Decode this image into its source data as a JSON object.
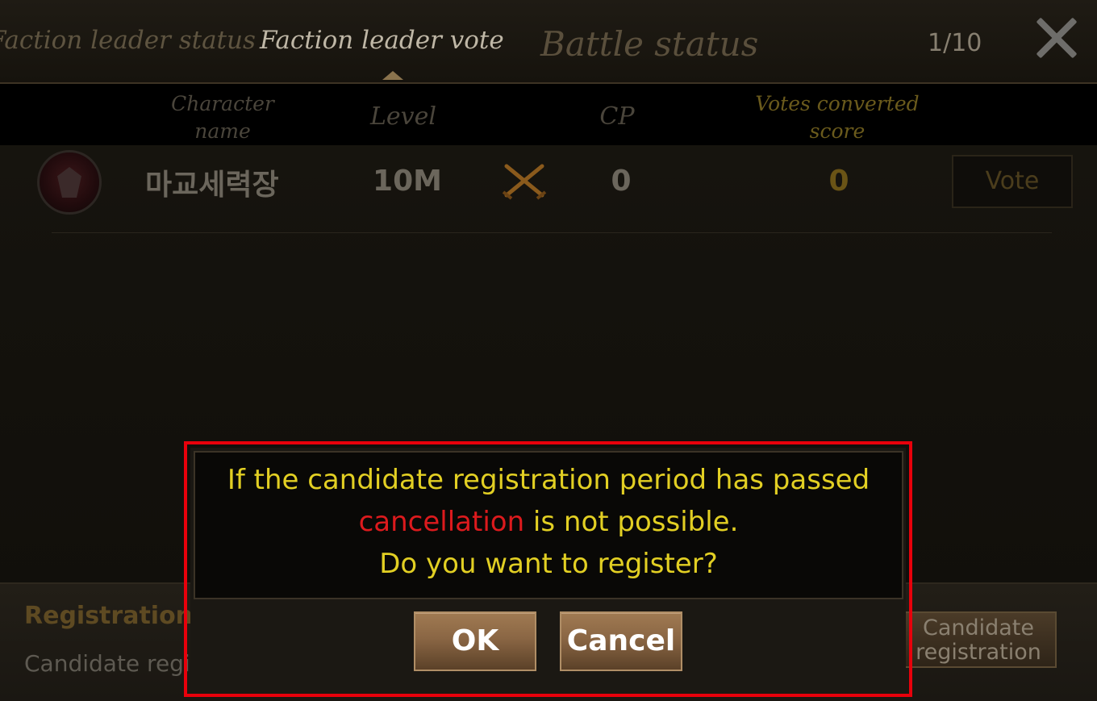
{
  "header": {
    "tabs": [
      {
        "label": "Faction leader status"
      },
      {
        "label": "Faction leader vote"
      },
      {
        "label": "Battle status"
      }
    ],
    "page_counter": "1/10",
    "close_icon": "close-icon"
  },
  "table": {
    "columns": [
      "Character name",
      "Level",
      "CP",
      "Votes converted score"
    ],
    "rows": [
      {
        "avatar_icon": "character-avatar",
        "name": "마교세력장",
        "level": "10M",
        "class_icon": "crossed-swords-icon",
        "cp": "0",
        "votes": "0",
        "vote_label": "Vote"
      }
    ]
  },
  "footer": {
    "title": "Registration Period",
    "text": "Candidate registration",
    "candidate_button_line1": "Candidate",
    "candidate_button_line2": "registration"
  },
  "dialog": {
    "line1": "If the candidate registration period has passed",
    "line2_highlight": "cancellation",
    "line2_rest": " is not possible.",
    "line3": "Do you want to register?",
    "ok_label": "OK",
    "cancel_label": "Cancel"
  },
  "colors": {
    "highlight_red": "#dc1a1d",
    "message_yellow": "#e2cf23",
    "outline_red": "#e8000b"
  }
}
